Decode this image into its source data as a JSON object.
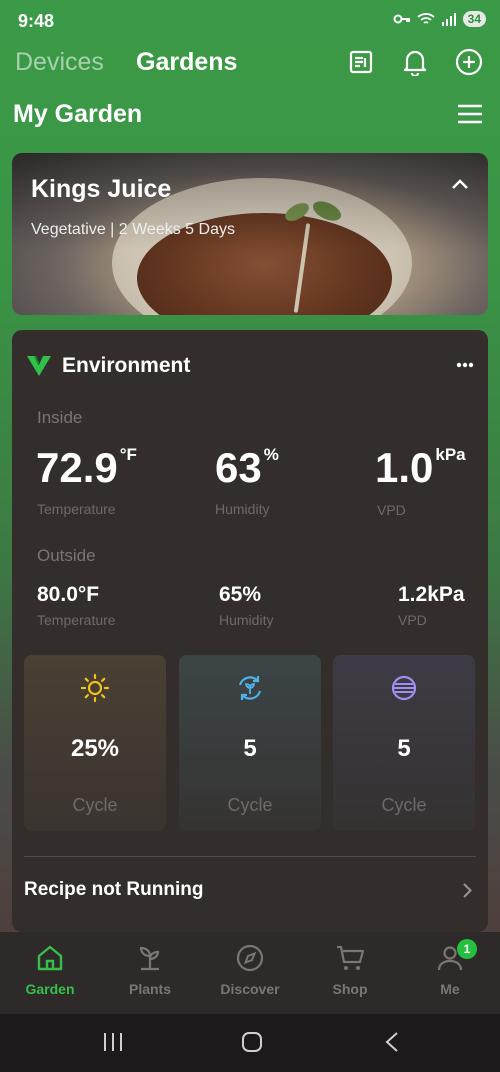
{
  "status": {
    "time": "9:48",
    "battery": "34"
  },
  "header": {
    "tab_devices": "Devices",
    "tab_gardens": "Gardens",
    "title": "My Garden"
  },
  "plant": {
    "name": "Kings Juice",
    "stage": "Vegetative | 2 Weeks 5 Days"
  },
  "environment": {
    "title": "Environment",
    "inside_label": "Inside",
    "inside": {
      "temperature": {
        "value": "72.9",
        "unit": "°F",
        "label": "Temperature"
      },
      "humidity": {
        "value": "63",
        "unit": "%",
        "label": "Humidity"
      },
      "vpd": {
        "value": "1.0",
        "unit": "kPa",
        "label": "VPD"
      }
    },
    "outside_label": "Outside",
    "outside": {
      "temperature": {
        "value": "80.0°F",
        "label": "Temperature"
      },
      "humidity": {
        "value": "65%",
        "label": "Humidity"
      },
      "vpd": {
        "value": "1.2kPa",
        "label": "VPD"
      }
    },
    "tiles": [
      {
        "icon": "sun-icon",
        "value": "25%",
        "label": "Cycle",
        "color": "#f2c21b"
      },
      {
        "icon": "circulation-fan-icon",
        "value": "5",
        "label": "Cycle",
        "color": "#4fb3e8"
      },
      {
        "icon": "exhaust-fan-icon",
        "value": "5",
        "label": "Cycle",
        "color": "#a48cf0"
      }
    ],
    "recipe_status": "Recipe not Running"
  },
  "bottom_nav": {
    "items": [
      {
        "label": "Garden",
        "icon": "home-icon",
        "active": true
      },
      {
        "label": "Plants",
        "icon": "sprout-icon"
      },
      {
        "label": "Discover",
        "icon": "compass-icon"
      },
      {
        "label": "Shop",
        "icon": "cart-icon"
      },
      {
        "label": "Me",
        "icon": "user-icon",
        "badge": "1"
      }
    ]
  },
  "colors": {
    "accent": "#36c04a",
    "card_bg": "#332e2c",
    "header_green": "#3b9a47"
  }
}
